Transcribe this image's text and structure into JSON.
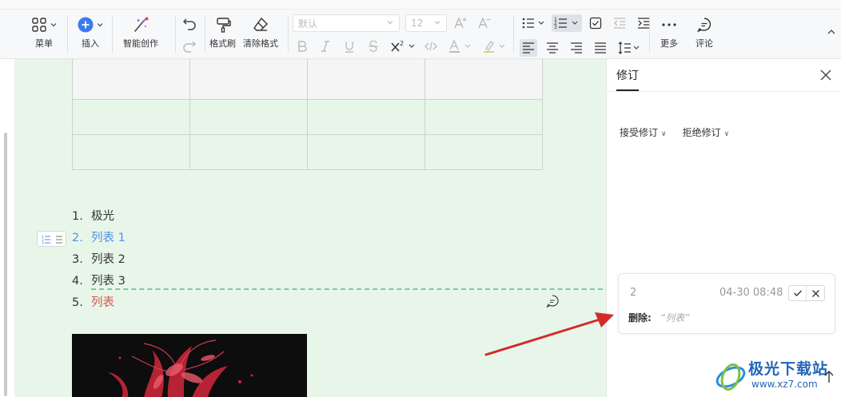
{
  "toolbar": {
    "menu_label": "菜单",
    "insert_label": "插入",
    "ai_label": "智能创作",
    "format_painter_label": "格式刷",
    "clear_format_label": "清除格式",
    "font_family_value": "默认",
    "font_size_value": "12",
    "more_label": "更多",
    "comment_label": "评论",
    "accent_color": "#3a7bf0",
    "active_bg": "#dfe3e8"
  },
  "document": {
    "bg_color": "#e8f6ea",
    "table": {
      "rows": 3,
      "cols": 4
    },
    "list": [
      {
        "num": "1.",
        "text": "极光",
        "state": "normal"
      },
      {
        "num": "2.",
        "text": "列表 1",
        "state": "inserted"
      },
      {
        "num": "3.",
        "text": "列表 2",
        "state": "normal"
      },
      {
        "num": "4.",
        "text": "列表 3",
        "state": "normal"
      },
      {
        "num": "5.",
        "text": "列表",
        "state": "deleted"
      }
    ],
    "inserted_color": "#4f8fe8",
    "deleted_color": "#d9534f"
  },
  "panel": {
    "tab_label": "修订",
    "accept_label": "接受修订",
    "reject_label": "拒绝修订",
    "revision": {
      "number": "2",
      "time": "04-30 08:48",
      "delete_label": "删除:",
      "deleted_text": "“列表”"
    }
  },
  "watermark": {
    "text": "极光下载站",
    "url": "www.xz7.com"
  }
}
